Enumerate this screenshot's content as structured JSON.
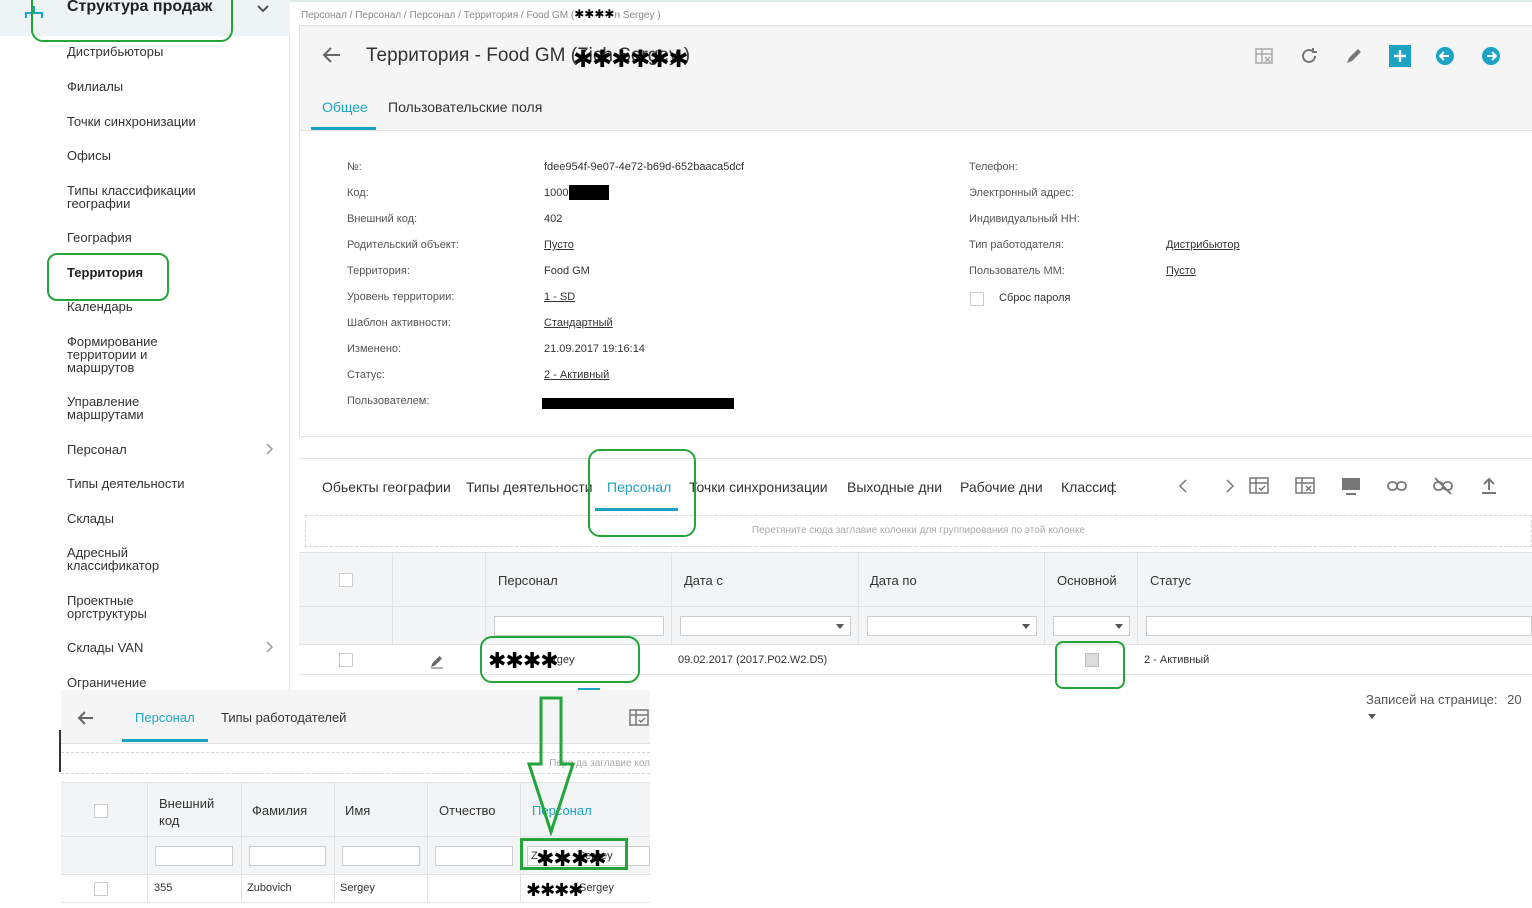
{
  "sidebar": {
    "header": "Структура продаж",
    "items": [
      {
        "label": "Дистрибьюторы"
      },
      {
        "label": "Филиалы"
      },
      {
        "label": "Точки синхронизации"
      },
      {
        "label": "Офисы"
      },
      {
        "label": "Типы классификации географии"
      },
      {
        "label": "География"
      },
      {
        "label": "Территория"
      },
      {
        "label": "Календарь"
      },
      {
        "label": "Формирование территории и маршрутов"
      },
      {
        "label": "Управление маршрутами"
      },
      {
        "label": "Персонал"
      },
      {
        "label": "Типы деятельности"
      },
      {
        "label": "Склады"
      },
      {
        "label": "Адресный классификатор"
      },
      {
        "label": "Проектные оргструктуры"
      },
      {
        "label": "Склады VAN"
      },
      {
        "label": "Ограничение"
      }
    ]
  },
  "breadcrumb": "Персонал / Персонал / Персонал / Территория / Food GM (",
  "breadcrumb_tail": "n Sergey )",
  "header": {
    "title_prefix": "Территория - Food GM (Z",
    "title_suffix": "ich Sergey )",
    "tabs": [
      "Общее",
      "Пользовательские поля"
    ]
  },
  "fields_left": [
    {
      "label": "№:",
      "value": "fdee954f-9e07-4e72-b69d-652baaca5dcf",
      "link": false
    },
    {
      "label": "Код:",
      "value": "1000",
      "link": false
    },
    {
      "label": "Внешний код:",
      "value": "402",
      "link": false
    },
    {
      "label": "Родительский объект:",
      "value": "Пусто",
      "link": true
    },
    {
      "label": "Территория:",
      "value": "Food GM",
      "link": false
    },
    {
      "label": "Уровень территории:",
      "value": "1 - SD",
      "link": true
    },
    {
      "label": "Шаблон активности:",
      "value": "Стандартный",
      "link": true
    },
    {
      "label": "Изменено:",
      "value": "21.09.2017 19:16:14",
      "link": false
    },
    {
      "label": "Статус:",
      "value": "2 - Активный",
      "link": true
    },
    {
      "label": "Пользователем:",
      "value": "",
      "link": false
    }
  ],
  "fields_right": [
    {
      "label": "Телефон:",
      "value": "",
      "link": false
    },
    {
      "label": "Электронный адрес:",
      "value": "",
      "link": false
    },
    {
      "label": "Индивидуальный НН:",
      "value": "",
      "link": false
    },
    {
      "label": "Тип работодателя:",
      "value": "Дистрибьютор",
      "link": true
    },
    {
      "label": "Пользователь ММ:",
      "value": "Пусто",
      "link": true
    }
  ],
  "reset_password_label": "Сброс пароля",
  "detail": {
    "tabs": [
      "Обьекты географии",
      "Типы деятельности",
      "Персонал",
      "Точки синхронизации",
      "Выходные дни",
      "Рабочие дни",
      "Классиф"
    ],
    "group_hint": "Перетяните сюда заглавие колонки для группирования по этой колонке",
    "columns": [
      "Персонал",
      "Дата с",
      "Дата по",
      "Основной",
      "Статус"
    ],
    "row": {
      "personal_suffix": "ergey",
      "date_from": "09.02.2017 (2017.P02.W2.D5)",
      "date_to": "",
      "status": "2 - Активный"
    }
  },
  "pager": {
    "label": "Записей на странице:",
    "value": "20"
  },
  "lookup": {
    "tabs": [
      "Персонал",
      "Типы работодателей"
    ],
    "group_hint": "Пере          да заглавие кол",
    "columns": [
      "Внешний код",
      "Фамилия",
      "Имя",
      "Отчество",
      "Персонал"
    ],
    "filter_value_prefix": "Z",
    "filter_value_suffix": "Sergey",
    "row": {
      "ext_code": "355",
      "last_name": "Zubovich",
      "first_name": "Sergey",
      "middle_name": "",
      "personal_suffix": "Sergey"
    }
  },
  "stars": "✱✱✱✱",
  "stars_long": "✱✱✱✱✱✱",
  "colors": {
    "accent": "#1ba3c6",
    "highlight": "#23a53a",
    "add_button": "#1ba3c6"
  },
  "icons": [
    "sales-structure-icon",
    "chevron-down-icon",
    "chevron-right-icon",
    "back-arrow-icon",
    "grid-settings-icon",
    "refresh-icon",
    "edit-pencil-icon",
    "add-icon",
    "prev-record-icon",
    "next-record-icon",
    "link-icon",
    "unlink-icon",
    "export-icon"
  ]
}
